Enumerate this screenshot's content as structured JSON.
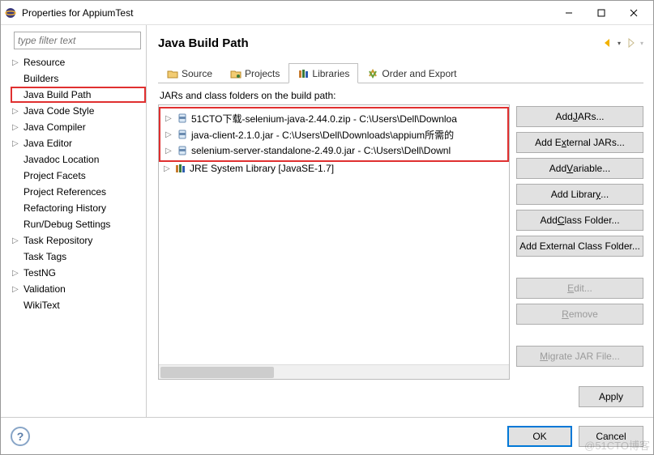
{
  "window": {
    "title": "Properties for AppiumTest"
  },
  "sidebar": {
    "filter_placeholder": "type filter text",
    "items": [
      {
        "label": "Resource",
        "expandable": true
      },
      {
        "label": "Builders",
        "expandable": false
      },
      {
        "label": "Java Build Path",
        "expandable": false,
        "selected": true
      },
      {
        "label": "Java Code Style",
        "expandable": true
      },
      {
        "label": "Java Compiler",
        "expandable": true
      },
      {
        "label": "Java Editor",
        "expandable": true
      },
      {
        "label": "Javadoc Location",
        "expandable": false
      },
      {
        "label": "Project Facets",
        "expandable": false
      },
      {
        "label": "Project References",
        "expandable": false
      },
      {
        "label": "Refactoring History",
        "expandable": false
      },
      {
        "label": "Run/Debug Settings",
        "expandable": false
      },
      {
        "label": "Task Repository",
        "expandable": true
      },
      {
        "label": "Task Tags",
        "expandable": false
      },
      {
        "label": "TestNG",
        "expandable": true
      },
      {
        "label": "Validation",
        "expandable": true
      },
      {
        "label": "WikiText",
        "expandable": false
      }
    ]
  },
  "main": {
    "title": "Java Build Path",
    "tabs": [
      {
        "label": "Source",
        "icon": "source-folder-icon"
      },
      {
        "label": "Projects",
        "icon": "projects-icon"
      },
      {
        "label": "Libraries",
        "icon": "libraries-icon",
        "active": true
      },
      {
        "label": "Order and Export",
        "icon": "order-export-icon"
      }
    ],
    "subtitle": "JARs and class folders on the build path:",
    "jars": [
      {
        "label": "51CTO下载-selenium-java-2.44.0.zip - C:\\Users\\Dell\\Downloa",
        "icon": "jar-icon"
      },
      {
        "label": "java-client-2.1.0.jar - C:\\Users\\Dell\\Downloads\\appium所需的",
        "icon": "jar-icon"
      },
      {
        "label": "selenium-server-standalone-2.49.0.jar - C:\\Users\\Dell\\Downl",
        "icon": "jar-icon"
      }
    ],
    "sys_library": {
      "label": "JRE System Library [JavaSE-1.7]",
      "icon": "library-icon"
    },
    "buttons": {
      "add_jars": "Add JARs...",
      "add_external_jars": "Add External JARs...",
      "add_variable": "Add Variable...",
      "add_library": "Add Library...",
      "add_class_folder": "Add Class Folder...",
      "add_external_class_folder": "Add External Class Folder...",
      "edit": "Edit...",
      "remove": "Remove",
      "migrate": "Migrate JAR File..."
    },
    "apply": "Apply"
  },
  "footer": {
    "ok": "OK",
    "cancel": "Cancel"
  },
  "watermark": "@51CTO博客"
}
